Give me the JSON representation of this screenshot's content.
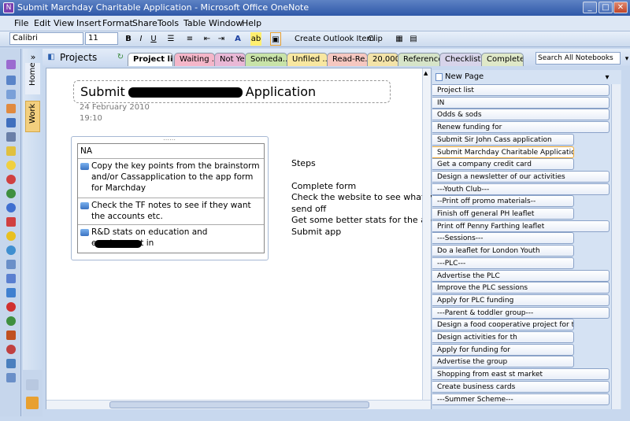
{
  "window": {
    "title": "Submit Marchday Charitable Application - Microsoft Office OneNote"
  },
  "menu": [
    "File",
    "Edit",
    "View",
    "Insert",
    "Format",
    "Share",
    "Tools",
    "Table",
    "Window",
    "Help"
  ],
  "toolbar": {
    "font": "Calibri",
    "size": "11",
    "bold": "B",
    "italic": "I",
    "underline": "U",
    "outlook_item": "Create Outlook Item",
    "clip": "Clip"
  },
  "notebook": {
    "title": "Projects",
    "search_placeholder": "Search All Notebooks"
  },
  "section_tabs": [
    {
      "label": "Project list",
      "color": "#ffffff"
    },
    {
      "label": "Waiting ...",
      "color": "#f4b6c9"
    },
    {
      "label": "Not Yet",
      "color": "#e9b8d6"
    },
    {
      "label": "Someda...",
      "color": "#c8e3a8"
    },
    {
      "label": "Unfiled ...",
      "color": "#f8e7a0"
    },
    {
      "label": "Read-Re...",
      "color": "#f5c7c0"
    },
    {
      "label": "20,000",
      "color": "#f3e3a8"
    },
    {
      "label": "Reference",
      "color": "#d6e4c8"
    },
    {
      "label": "Checklists",
      "color": "#d7d4ea"
    },
    {
      "label": "Complete",
      "color": "#dfe8c8"
    }
  ],
  "side_sections": [
    "Home",
    "Work"
  ],
  "page": {
    "title_prefix": "Submit",
    "title_suffix": "Application",
    "date": "24 February 2010",
    "time": "19:10",
    "table_header": "NA",
    "tasks": [
      "Copy the key points from the brainstorm and/or Cassapplication to the app form for Marchday",
      "Check the TF notes to see if they want the accounts etc.",
      "R&D stats on education and employment in"
    ],
    "steps": [
      "Steps",
      "",
      "Complete form",
      "Check the website to see what we",
      "send off",
      "Get some better stats for the applic",
      "Submit app"
    ]
  },
  "page_list": {
    "new_page": "New Page",
    "items": [
      "Project list",
      "IN",
      "Odds & sods",
      "Renew funding for",
      "Submit Sir John Cass application",
      "Submit Marchday Charitable Application",
      "Get a company credit card",
      "Design a newsletter of our activities",
      "---Youth Club---",
      "--Print off promo materials--",
      "Finish off general PH leaflet",
      "Print off Penny Farthing leaflet",
      "---Sessions---",
      "Do a leaflet for London Youth",
      "---PLC---",
      "Advertise the PLC",
      "Improve the PLC sessions",
      "Apply for PLC funding",
      "---Parent & toddler group---",
      "Design a food cooperative project for the par",
      "Design activities for th",
      "Apply for funding for",
      "Advertise the group",
      "Shopping from east st market",
      "Create business cards",
      "---Summer Scheme---"
    ]
  }
}
